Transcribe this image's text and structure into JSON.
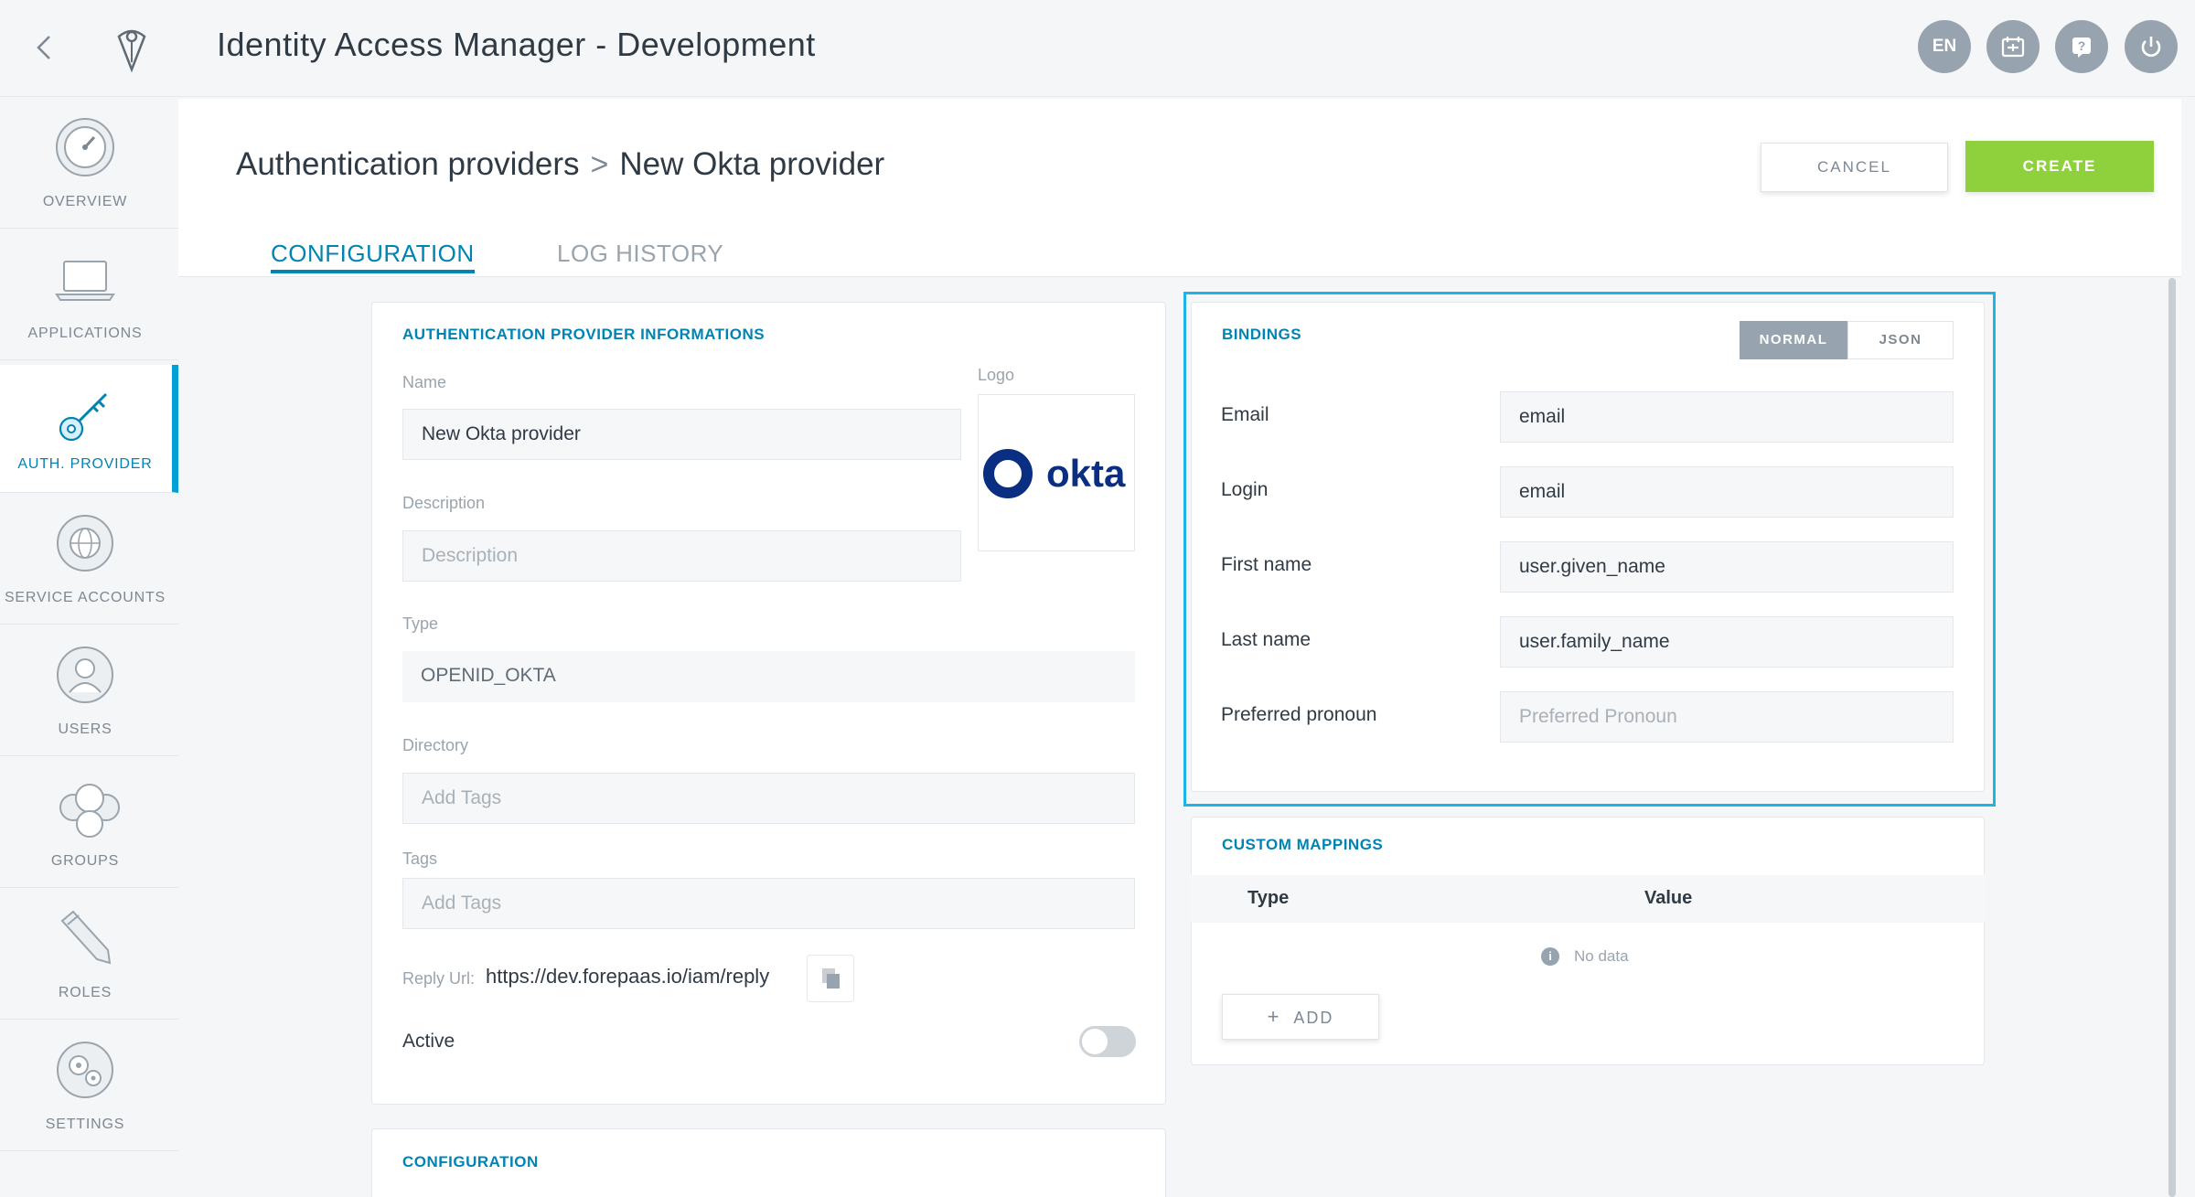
{
  "app": {
    "title": "Identity Access Manager - Development",
    "language_badge": "EN",
    "top_icons": [
      "calendar-icon",
      "help-icon",
      "power-icon"
    ]
  },
  "sidebar": {
    "items": [
      {
        "label": "OVERVIEW",
        "icon": "gauge-icon",
        "active": false
      },
      {
        "label": "APPLICATIONS",
        "icon": "laptop-icon",
        "active": false
      },
      {
        "label": "AUTH. PROVIDER",
        "icon": "key-icon",
        "active": true
      },
      {
        "label": "SERVICE ACCOUNTS",
        "icon": "globe-icon",
        "active": false
      },
      {
        "label": "USERS",
        "icon": "user-icon",
        "active": false
      },
      {
        "label": "GROUPS",
        "icon": "group-icon",
        "active": false
      },
      {
        "label": "ROLES",
        "icon": "pencil-icon",
        "active": false
      },
      {
        "label": "SETTINGS",
        "icon": "gears-icon",
        "active": false
      }
    ]
  },
  "header": {
    "breadcrumb_root": "Authentication providers",
    "breadcrumb_separator": ">",
    "breadcrumb_current": "New Okta provider",
    "cancel_label": "CANCEL",
    "create_label": "CREATE"
  },
  "tabs": [
    {
      "label": "CONFIGURATION",
      "active": true
    },
    {
      "label": "LOG HISTORY",
      "active": false
    }
  ],
  "info_card": {
    "title": "AUTHENTICATION PROVIDER INFORMATIONS",
    "name_label": "Name",
    "name_value": "New Okta provider",
    "logo_label": "Logo",
    "logo_text": "okta",
    "description_label": "Description",
    "description_placeholder": "Description",
    "type_label": "Type",
    "type_value": "OPENID_OKTA",
    "directory_label": "Directory",
    "directory_placeholder": "Add Tags",
    "tags_label": "Tags",
    "tags_placeholder": "Add Tags",
    "reply_url_label": "Reply Url:",
    "reply_url_value": "https://dev.forepaas.io/iam/reply",
    "active_label": "Active",
    "active_value": false
  },
  "config_card": {
    "title": "CONFIGURATION"
  },
  "bindings": {
    "title": "BINDINGS",
    "mode_normal": "NORMAL",
    "mode_json": "JSON",
    "selected_mode": "NORMAL",
    "rows": [
      {
        "label": "Email",
        "value": "email",
        "placeholder": ""
      },
      {
        "label": "Login",
        "value": "email",
        "placeholder": ""
      },
      {
        "label": "First name",
        "value": "user.given_name",
        "placeholder": ""
      },
      {
        "label": "Last name",
        "value": "user.family_name",
        "placeholder": ""
      },
      {
        "label": "Preferred pronoun",
        "value": "",
        "placeholder": "Preferred Pronoun"
      }
    ]
  },
  "custom_mappings": {
    "title": "CUSTOM MAPPINGS",
    "col_type": "Type",
    "col_value": "Value",
    "empty_text": "No data",
    "add_label": "ADD"
  },
  "colors": {
    "accent": "#0084b4",
    "highlight": "#1eb4e6",
    "create_green": "#8ed13c",
    "okta_blue": "#0a2e82"
  }
}
